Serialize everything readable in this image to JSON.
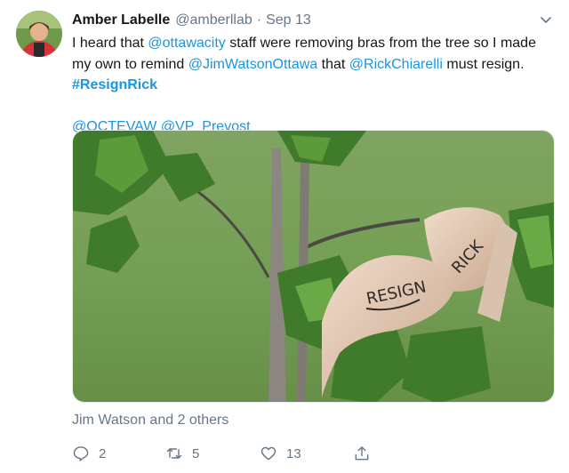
{
  "tweet": {
    "author_name": "Amber Labelle",
    "author_handle": "@amberllab",
    "separator": "·",
    "date": "Sep 13",
    "text_1": "I heard that ",
    "mention_ottawacity": "@ottawacity",
    "text_2": " staff were removing bras from the tree so I made",
    "text_3": "my own to remind ",
    "mention_jimwatson": "@JimWatsonOttawa",
    "text_4": " that ",
    "mention_rick": "@RickChiarelli",
    "text_5": " must resign.",
    "hashtag": "#ResignRick",
    "mention_octevaw": "@OCTEVAW",
    "mention_vp_prevost": "@VP_Prevost",
    "image_text_1": "RESIGN",
    "image_text_2": "RICK",
    "liked_by": "Jim Watson and 2 others"
  },
  "actions": {
    "reply_count": "2",
    "retweet_count": "5",
    "like_count": "13"
  },
  "icons": {
    "caret": "chevron-down-icon",
    "reply": "reply-icon",
    "retweet": "retweet-icon",
    "like": "heart-icon",
    "share": "share-icon"
  },
  "colors": {
    "link": "#1b95e0",
    "secondary_text": "#657786",
    "primary_text": "#14171a"
  }
}
